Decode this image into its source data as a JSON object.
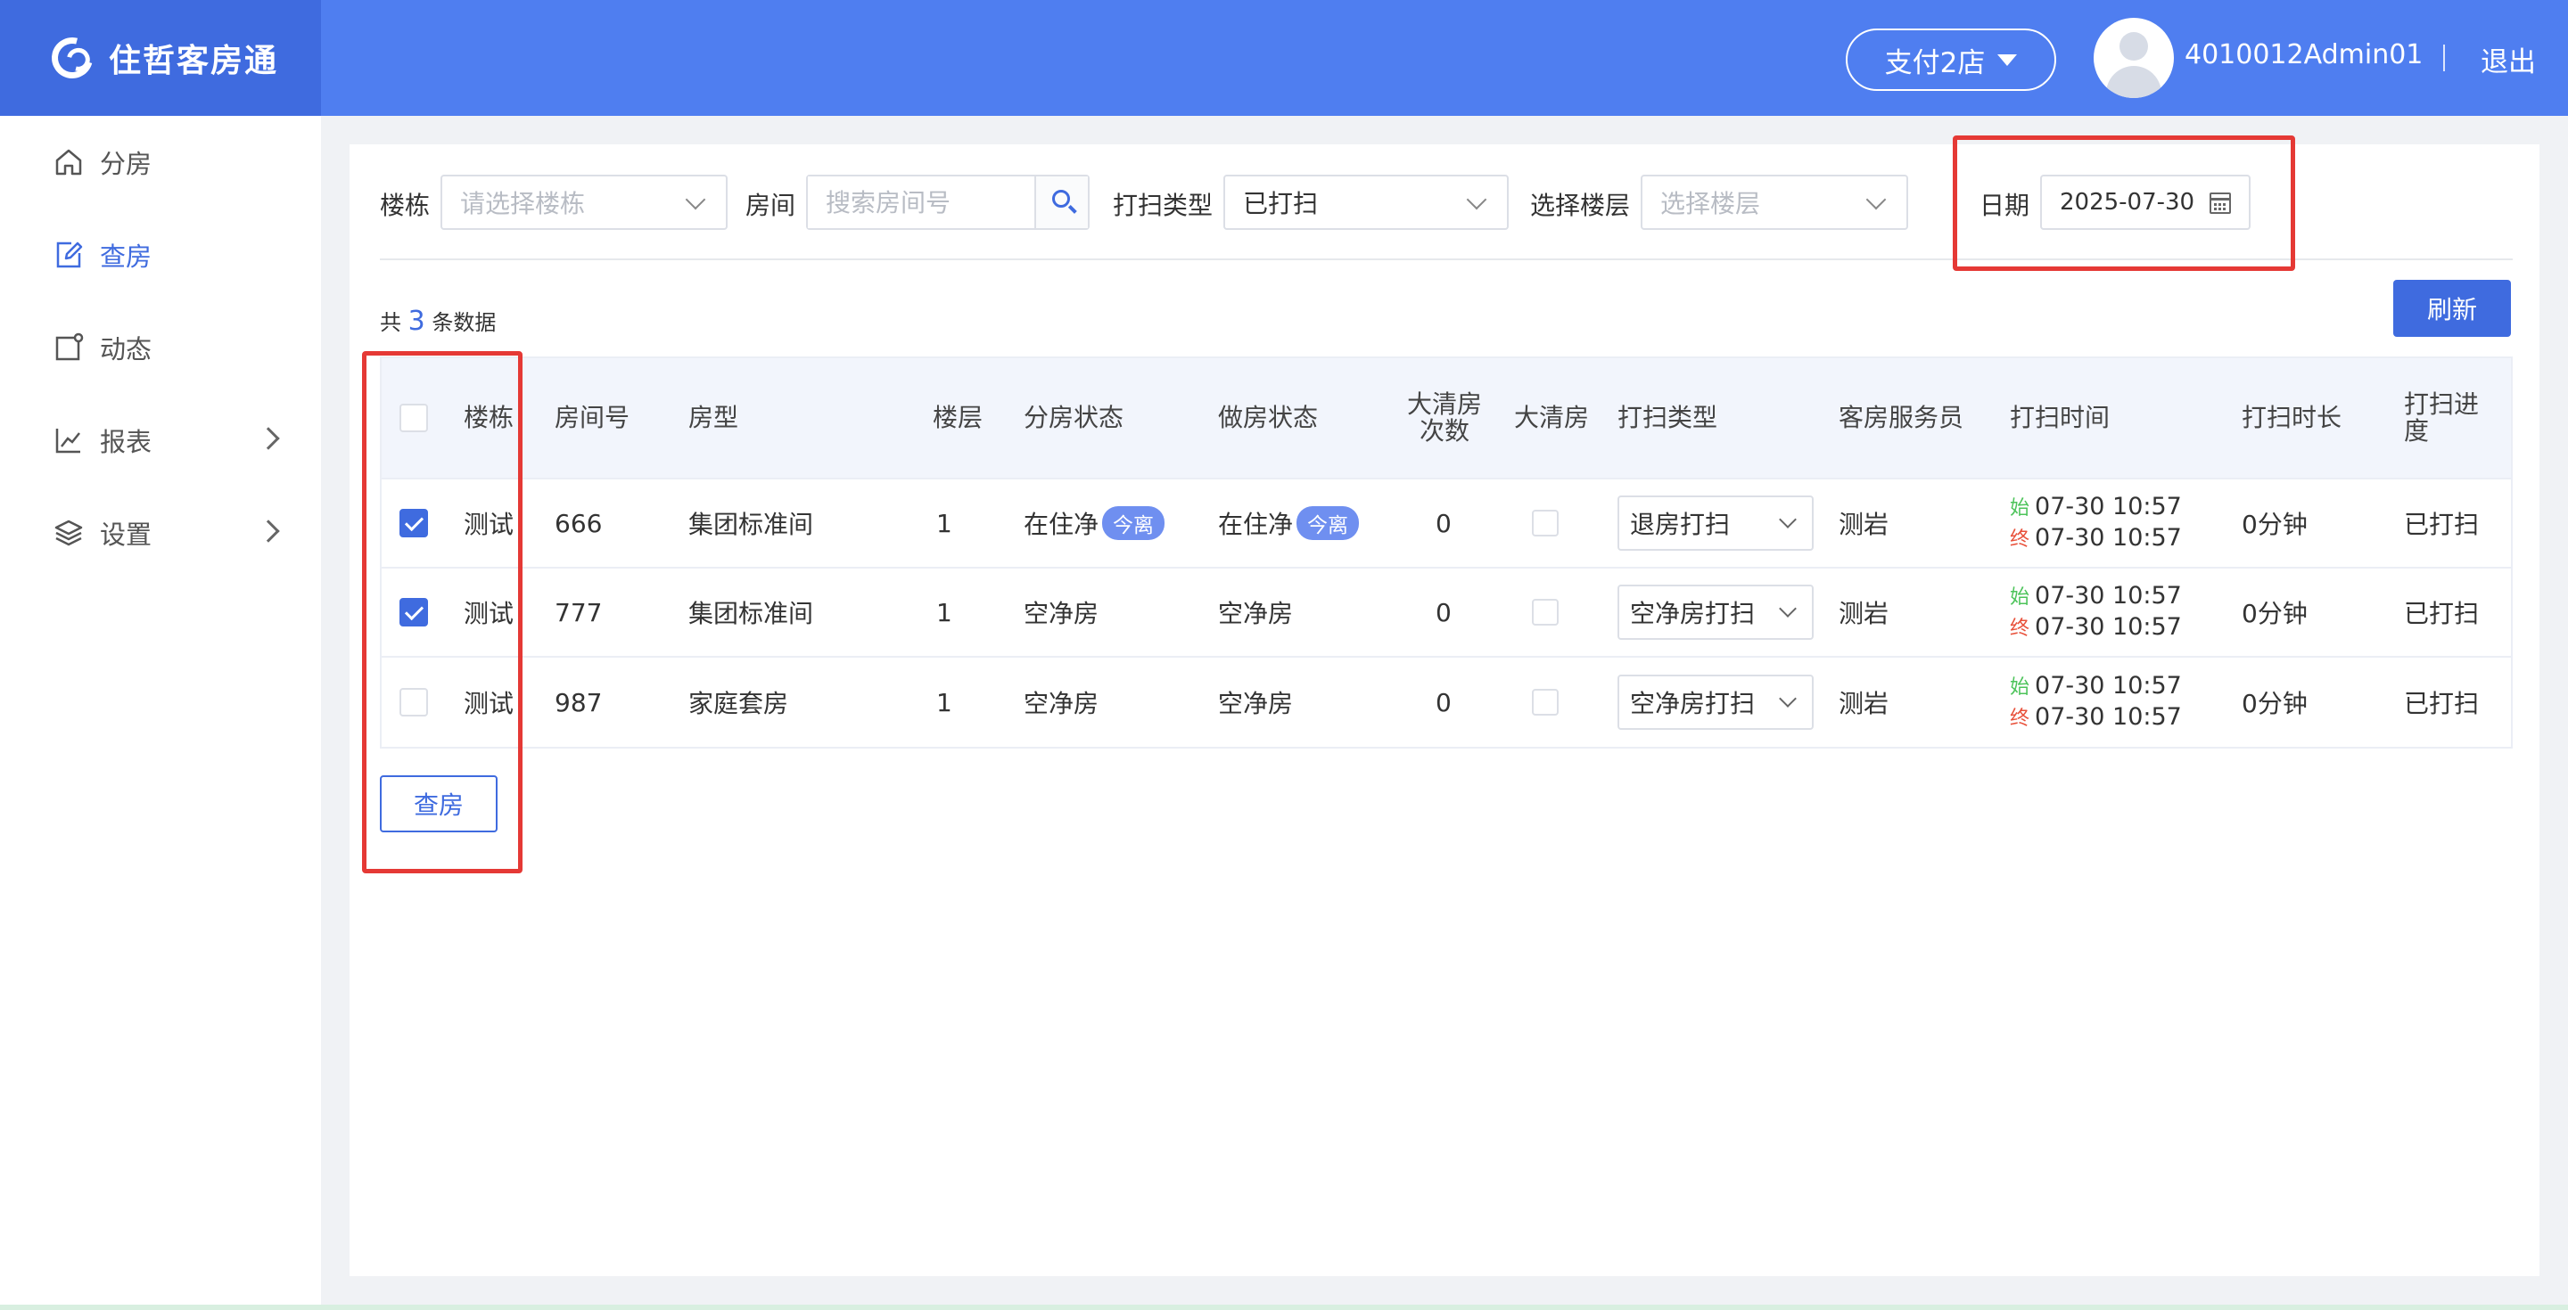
{
  "app": {
    "name": "住哲客房通"
  },
  "header": {
    "store_label": "支付2店",
    "username": "4010012Admin01",
    "logout_label": "退出"
  },
  "sidebar": {
    "items": [
      {
        "label": "分房",
        "icon": "home-icon"
      },
      {
        "label": "查房",
        "icon": "edit-doc-icon"
      },
      {
        "label": "动态",
        "icon": "activity-icon"
      },
      {
        "label": "报表",
        "icon": "chart-icon"
      },
      {
        "label": "设置",
        "icon": "layers-icon"
      }
    ],
    "active_index": 1
  },
  "filters": {
    "building_label": "楼栋",
    "building_placeholder": "请选择楼栋",
    "room_label": "房间",
    "room_placeholder": "搜索房间号",
    "clean_type_label": "打扫类型",
    "clean_type_value": "已打扫",
    "floor_label": "选择楼层",
    "floor_placeholder": "选择楼层",
    "date_label": "日期",
    "date_value": "2025-07-30"
  },
  "summary": {
    "prefix": "共",
    "count": "3",
    "suffix": "条数据"
  },
  "refresh_label": "刷新",
  "table": {
    "headers": {
      "building": "楼栋",
      "room_no": "房间号",
      "room_type": "房型",
      "floor": "楼层",
      "assign_status": "分房状态",
      "make_status": "做房状态",
      "deep_clean_count": "大清房次数",
      "deep_clean": "大清房",
      "clean_type": "打扫类型",
      "attendant": "客房服务员",
      "clean_time": "打扫时间",
      "duration": "打扫时长",
      "progress": "打扫进度"
    },
    "start_label": "始",
    "end_label": "终",
    "rows": [
      {
        "checked": true,
        "building": "测试",
        "room_no": "666",
        "room_type": "集团标准间",
        "floor": "1",
        "assign_status": "在住净",
        "assign_tag": "今离",
        "make_status": "在住净",
        "make_tag": "今离",
        "deep_clean_count": "0",
        "clean_type": "退房打扫",
        "attendant": "测岩",
        "start": "07-30 10:57",
        "end": "07-30 10:57",
        "duration": "0分钟",
        "progress": "已打扫"
      },
      {
        "checked": true,
        "building": "测试",
        "room_no": "777",
        "room_type": "集团标准间",
        "floor": "1",
        "assign_status": "空净房",
        "assign_tag": "",
        "make_status": "空净房",
        "make_tag": "",
        "deep_clean_count": "0",
        "clean_type": "空净房打扫",
        "attendant": "测岩",
        "start": "07-30 10:57",
        "end": "07-30 10:57",
        "duration": "0分钟",
        "progress": "已打扫"
      },
      {
        "checked": false,
        "building": "测试",
        "room_no": "987",
        "room_type": "家庭套房",
        "floor": "1",
        "assign_status": "空净房",
        "assign_tag": "",
        "make_status": "空净房",
        "make_tag": "",
        "deep_clean_count": "0",
        "clean_type": "空净房打扫",
        "attendant": "测岩",
        "start": "07-30 10:57",
        "end": "07-30 10:57",
        "duration": "0分钟",
        "progress": "已打扫"
      }
    ]
  },
  "check_room_label": "查房",
  "colors": {
    "primary": "#3f6bdf",
    "header_bg": "#4f7ef0",
    "annotation": "#e53935"
  }
}
